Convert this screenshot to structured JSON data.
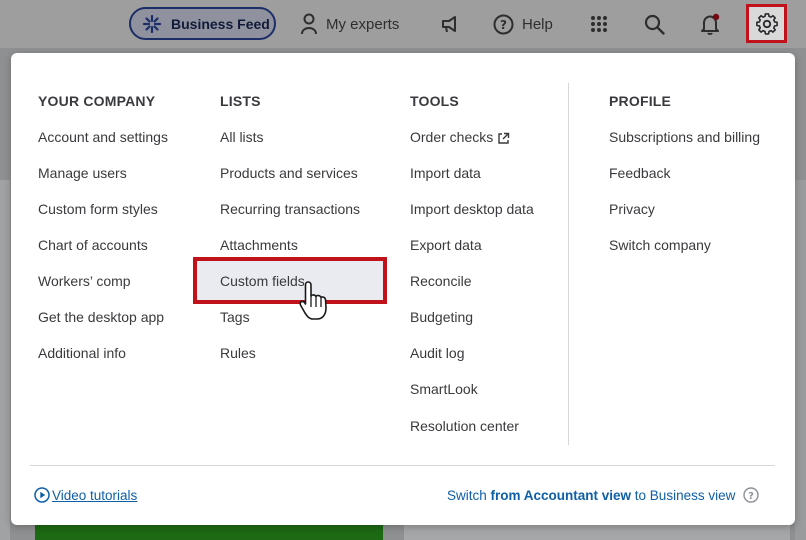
{
  "topbar": {
    "business_feed_label": "Business Feed",
    "my_experts_label": "My experts",
    "help_label": "Help"
  },
  "columns": {
    "your_company": {
      "heading": "YOUR COMPANY",
      "items": [
        "Account and settings",
        "Manage users",
        "Custom form styles",
        "Chart of accounts",
        "Workers’ comp",
        "Get the desktop app",
        "Additional info"
      ]
    },
    "lists": {
      "heading": "LISTS",
      "items": [
        "All lists",
        "Products and services",
        "Recurring transactions",
        "Attachments",
        "Custom fields",
        "Tags",
        "Rules"
      ]
    },
    "tools": {
      "heading": "TOOLS",
      "items": [
        "Order checks",
        "Import data",
        "Import desktop data",
        "Export data",
        "Reconcile",
        "Budgeting",
        "Audit log",
        "SmartLook",
        "Resolution center"
      ]
    },
    "profile": {
      "heading": "PROFILE",
      "items": [
        "Subscriptions and billing",
        "Feedback",
        "Privacy",
        "Switch company"
      ]
    }
  },
  "footer": {
    "video_tutorials": "Video tutorials",
    "switch_prefix": "Switch ",
    "switch_bold": "from Accountant view",
    "switch_suffix": " to Business view"
  },
  "colors": {
    "highlight_border": "#c1121c",
    "link": "#0d5fa8",
    "accent_pill": "#2c4aa8"
  },
  "icons": [
    "sparkle-icon",
    "person-icon",
    "megaphone-icon",
    "help-circle-icon",
    "apps-grid-icon",
    "search-icon",
    "bell-icon",
    "gear-icon",
    "external-link-icon",
    "play-circle-icon",
    "question-circle-icon",
    "hand-cursor-icon"
  ]
}
